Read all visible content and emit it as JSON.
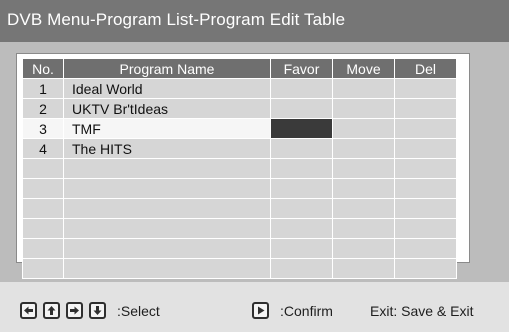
{
  "title": "DVB Menu-Program List-Program Edit Table",
  "table": {
    "columns": [
      "No.",
      "Program Name",
      "Favor",
      "Move",
      "Del"
    ],
    "rows": [
      {
        "no": "1",
        "name": "Ideal World"
      },
      {
        "no": "2",
        "name": "UKTV Br'tIdeas"
      },
      {
        "no": "3",
        "name": "TMF"
      },
      {
        "no": "4",
        "name": "The HITS"
      }
    ],
    "empty_rows": 6,
    "selected_row": 3
  },
  "footer": {
    "select_label": ":Select",
    "confirm_label": ":Confirm",
    "exit_label": "Exit: Save & Exit"
  },
  "icons": [
    "left-arrow-key-icon",
    "up-arrow-key-icon",
    "right-arrow-key-icon",
    "down-arrow-key-icon",
    "play-key-icon"
  ],
  "colors": {
    "title_bar": "#767676",
    "header": "#6f6f6f",
    "cell": "#d6d6d6",
    "selection": "#3a3a3a"
  }
}
